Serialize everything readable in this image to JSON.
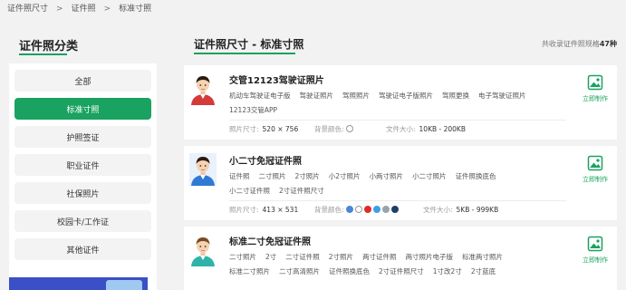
{
  "breadcrumb": {
    "items": [
      "证件照尺寸",
      "证件照",
      "标准寸照"
    ],
    "separator": ">"
  },
  "sidebar": {
    "title": "证件照分类",
    "items": [
      {
        "label": "全部",
        "active": false
      },
      {
        "label": "标准寸照",
        "active": true
      },
      {
        "label": "护照签证",
        "active": false
      },
      {
        "label": "职业证件",
        "active": false
      },
      {
        "label": "社保照片",
        "active": false
      },
      {
        "label": "校园卡/工作证",
        "active": false
      },
      {
        "label": "其他证件",
        "active": false
      }
    ]
  },
  "main": {
    "title": "证件照尺寸 - 标准寸照",
    "total": {
      "prefix": "共收录证件照规格",
      "count": "47种"
    }
  },
  "labels": {
    "size": "照片尺寸:",
    "bg": "背景颜色:",
    "file": "文件大小:",
    "make": "立即制作"
  },
  "cards": [
    {
      "title": "交管12123驾驶证照片",
      "tags": [
        "机动车驾驶证电子版",
        "驾驶证照片",
        "驾照照片",
        "驾驶证电子版照片",
        "驾照更换",
        "电子驾驶证照片",
        "12123交管APP"
      ],
      "size": "520 × 756",
      "bg_colors": [
        "#ffffff"
      ],
      "file_size": "10KB - 200KB",
      "avatar": {
        "shirt": "#d43a3a",
        "hair": "#2b1a10",
        "bg": "#ffffff"
      }
    },
    {
      "title": "小二寸免冠证件照",
      "tags": [
        "证件照",
        "二寸照片",
        "2寸照片",
        "小2寸照片",
        "小两寸照片",
        "小二寸照片",
        "证件照换底色",
        "小二寸证件照",
        "2寸证件照尺寸"
      ],
      "size": "413 × 531",
      "bg_colors": [
        "#4a86d8",
        "#ffffff",
        "#e02a2a",
        "#3aa0e8",
        "#9aa3ad",
        "#1f3f66"
      ],
      "file_size": "5KB - 999KB",
      "avatar": {
        "shirt": "#2e7bd6",
        "hair": "#2b1a10",
        "bg": "#e9f1fb"
      }
    },
    {
      "title": "标准二寸免冠证件照",
      "tags": [
        "二寸照片",
        "2寸",
        "二寸证件照",
        "2寸照片",
        "两寸证件照",
        "两寸照片电子版",
        "标准两寸照片",
        "标准二寸照片",
        "二寸高清照片",
        "证件照换底色",
        "2寸证件照尺寸",
        "1寸改2寸",
        "2寸蓝底"
      ],
      "avatar": {
        "shirt": "#2fb3a8",
        "hair": "#7a4a22",
        "bg": "#ffffff"
      }
    }
  ]
}
